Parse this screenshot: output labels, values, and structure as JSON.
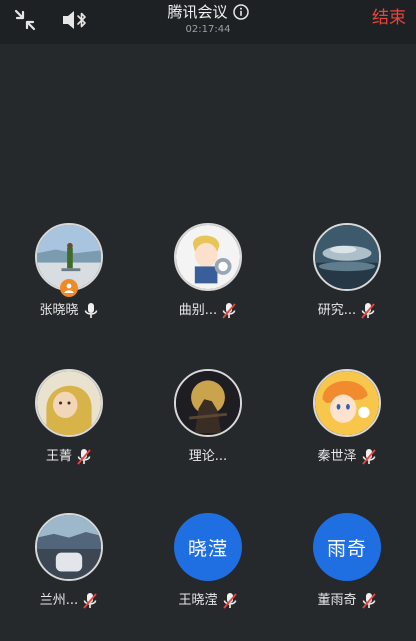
{
  "header": {
    "title": "腾讯会议",
    "timer": "02:17:44",
    "end_label": "结束",
    "icons": [
      "minimize-icon",
      "speaker-bluetooth-icon",
      "info-icon"
    ],
    "end_color": "#e8453c"
  },
  "participants": [
    {
      "name": "张晓晓",
      "avatar": "photo",
      "mic": "on",
      "host": true
    },
    {
      "name": "曲别...",
      "avatar": "photo",
      "mic": "muted"
    },
    {
      "name": "研究...",
      "avatar": "photo",
      "mic": "muted"
    },
    {
      "name": "王菁",
      "avatar": "photo",
      "mic": "muted"
    },
    {
      "name": "理论...",
      "avatar": "photo",
      "mic": "none"
    },
    {
      "name": "秦世泽",
      "avatar": "photo",
      "mic": "muted"
    },
    {
      "name": "兰州...",
      "avatar": "photo",
      "mic": "muted"
    },
    {
      "name": "王晓滢",
      "avatar": "text",
      "avatar_text": "晓滢",
      "mic": "muted"
    },
    {
      "name": "董雨奇",
      "avatar": "text",
      "avatar_text": "雨奇",
      "mic": "muted"
    }
  ],
  "colors": {
    "background": "#26292c",
    "topbar": "#1e2124",
    "avatar_fill": "#1f6fe3",
    "host_badge": "#f08a24",
    "muted_slash": "#e8453c"
  }
}
